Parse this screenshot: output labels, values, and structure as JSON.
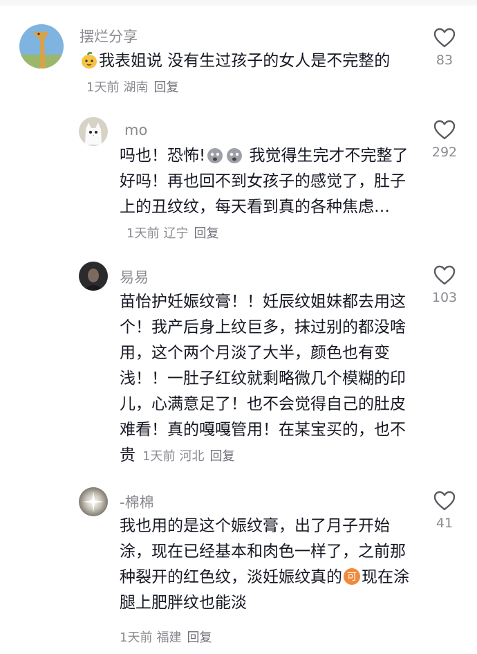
{
  "comments": [
    {
      "name": "摆烂分享",
      "text_after_emoji": "我表姐说 没有生过孩子的女人是不完整的",
      "time": "1天前",
      "location": "湖南",
      "reply": "回复",
      "likes": "83",
      "avatar": "giraffe-avatar",
      "leading_emoji": "mango-emoji"
    },
    {
      "name": "mo",
      "text_before": "吗也！恐怖!",
      "text_after": " 我觉得生完才不完整了好吗！再也回不到女孩子的感觉了，肚子上的丑纹纹，每天看到真的各种焦虑…",
      "time": "1天前",
      "location": "辽宁",
      "reply": "回复",
      "likes": "292",
      "avatar": "cat-avatar",
      "inline_emoji": "scared-face-emoji"
    },
    {
      "name": "易易",
      "text": "苗怡护妊娠纹膏！！妊辰纹姐妹都去用这个！我产后身上纹巨多，抹过别的都没啥用，这个两个月淡了大半，颜色也有变浅！！一肚子红纹就剩略微几个模糊的印儿，心满意足了！也不会觉得自己的肚皮难看！真的嘎嘎管用！在某宝买的，也不贵",
      "time": "1天前",
      "location": "河北",
      "reply": "回复",
      "likes": "103",
      "avatar": "person-avatar"
    },
    {
      "name": "-棉棉",
      "text_before": "我也用的是这个娠纹膏，出了月子开始涂，现在已经基本和肉色一样了，之前那种裂开的红色纹，淡妊娠纹真的",
      "text_after": "现在涂腿上肥胖纹也能淡",
      "time": "1天前",
      "location": "福建",
      "reply": "回复",
      "likes": "41",
      "avatar": "sparkle-avatar",
      "inline_emoji": "ke-badge-emoji"
    }
  ],
  "colors": {
    "text": "#161823",
    "secondary": "#8a8b91",
    "background": "#ffffff"
  },
  "icons": {
    "like": "heart-outline-icon"
  }
}
